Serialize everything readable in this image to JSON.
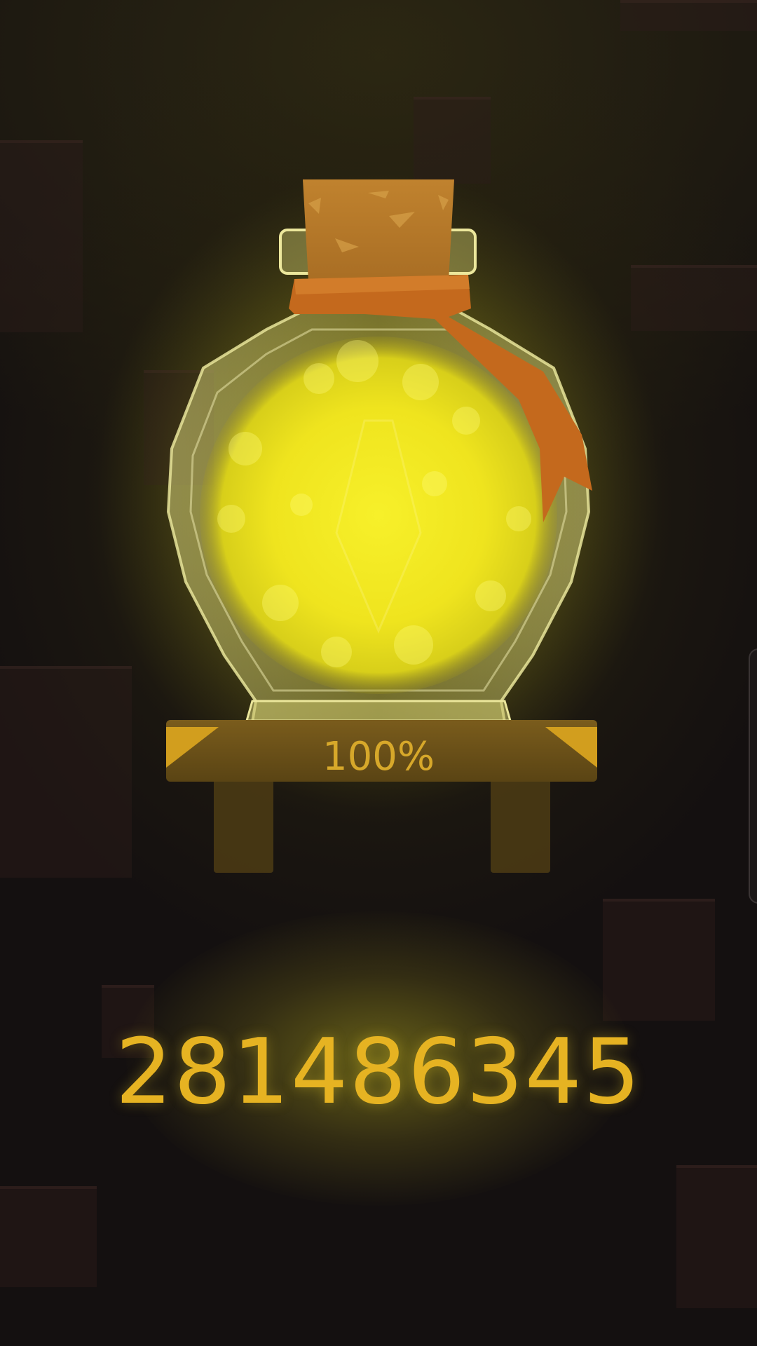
{
  "jar": {
    "fill_percent": 100,
    "fill_label": "100%",
    "liquid_color": "#f2ea1c",
    "cork_color": "#b97a2c",
    "ribbon_color": "#c76c1e"
  },
  "score": {
    "value": "281486345",
    "color": "#e6b322"
  },
  "icons": {
    "jar": "potion-jar-icon",
    "cork": "cork-icon",
    "ribbon": "ribbon-icon",
    "shelf": "wooden-shelf-icon",
    "side_handle": "side-panel-handle-icon"
  },
  "palette": {
    "background": "#141010",
    "glow": "#9c8f16",
    "shelf": "#6e5218",
    "shelf_corner": "#d29e1e"
  }
}
